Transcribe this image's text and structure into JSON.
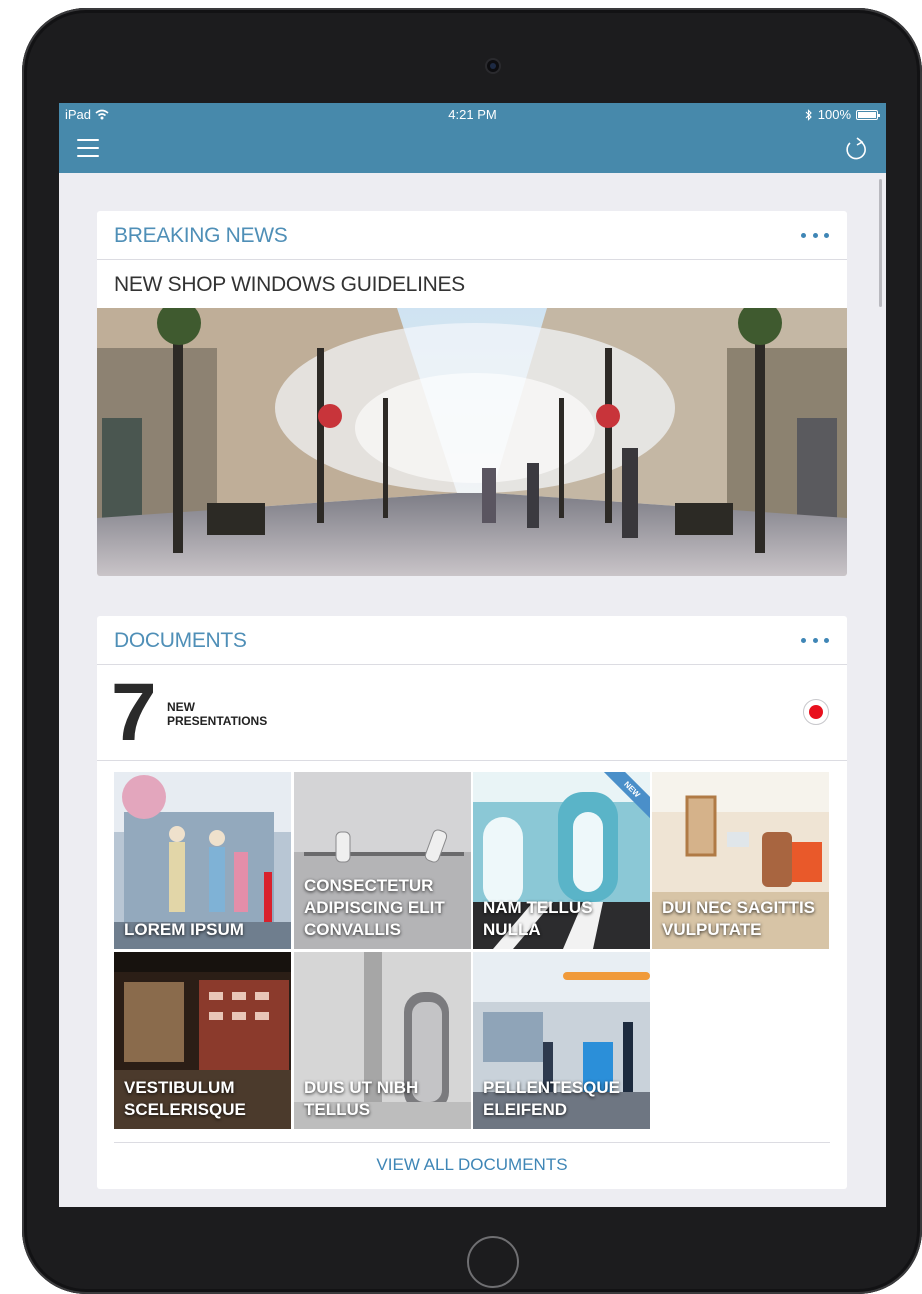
{
  "status_bar": {
    "device": "iPad",
    "time": "4:21 PM",
    "battery": "100%"
  },
  "nav": {
    "menu_icon": "hamburger-icon",
    "refresh_icon": "refresh-icon",
    "color": "#4789ab"
  },
  "breaking_news": {
    "title": "BREAKING NEWS",
    "headline": "NEW SHOP WINDOWS GUIDELINES",
    "more_icon": "more-dots-icon"
  },
  "documents": {
    "title": "DOCUMENTS",
    "count": "7",
    "count_label_line1": "NEW",
    "count_label_line2": "PRESENTATIONS",
    "tiles": [
      {
        "label": "LOREM IPSUM"
      },
      {
        "label": "CONSECTETUR ADIPISCING ELIT CONVALLIS"
      },
      {
        "label": "NAM TELLUS NULLA",
        "badge": "NEW"
      },
      {
        "label": "DUI NEC SAGITTIS VULPUTATE"
      },
      {
        "label": "VESTIBULUM SCELERISQUE"
      },
      {
        "label": "DUIS UT NIBH TELLUS"
      },
      {
        "label": "PELLENTESQUE ELEIFEND"
      }
    ],
    "view_all": "VIEW ALL DOCUMENTS"
  },
  "colors": {
    "accent": "#4f8fb7",
    "record": "#e8101d",
    "background": "#ededf2"
  }
}
